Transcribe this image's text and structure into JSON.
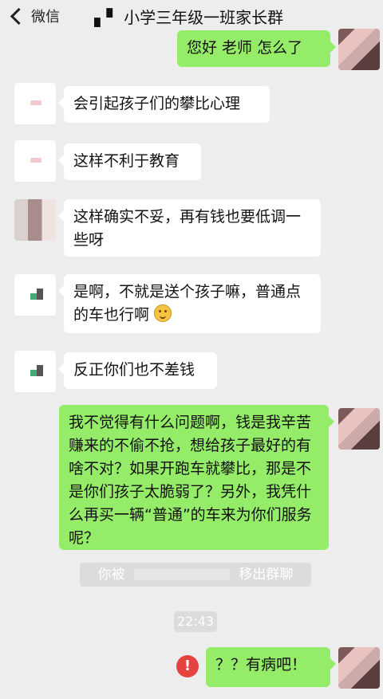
{
  "header": {
    "back_label": "微信",
    "chat_title": "▖▘ 小学三年级一班家长群"
  },
  "messages": [
    {
      "side": "right",
      "text": "您好 老师 怎么了"
    },
    {
      "side": "left",
      "text": "会引起孩子们的攀比心理"
    },
    {
      "side": "left",
      "text": "这样不利于教育"
    },
    {
      "side": "left",
      "text": "这样确实不妥，再有钱也要低调一些呀"
    },
    {
      "side": "left",
      "text": "是啊，不就是送个孩子嘛，普通点的车也行啊"
    },
    {
      "side": "left",
      "text": "反正你们也不差钱"
    },
    {
      "side": "right",
      "text": "我不觉得有什么问题啊，钱是我辛苦赚来的不偷不抢，想给孩子最好的有啥不对？如果开跑车就攀比，那是不是你们孩子太脆弱了？另外，我凭什么再买一辆“普通”的车来为你们服务呢？"
    },
    {
      "side": "right",
      "text": "？？有病吧！"
    }
  ],
  "system_notice": {
    "prefix": "你被",
    "suffix": "移出群聊"
  },
  "timestamp": "22:43",
  "send_failed_mark": "!",
  "icons": {
    "back": "chevron-left-icon",
    "error": "alert-icon",
    "emoji": "smirk-emoji-icon"
  },
  "colors": {
    "bubble_right": "#95ec69",
    "bubble_left": "#ffffff",
    "background": "#ededed",
    "error": "#e64340"
  }
}
